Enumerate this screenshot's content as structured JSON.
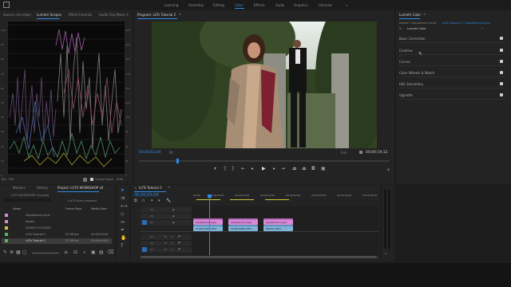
{
  "workspaces": {
    "items": [
      "Learning",
      "Assembly",
      "Editing",
      "Color",
      "Effects",
      "Audio",
      "Graphics",
      "Libraries"
    ],
    "active": "Color",
    "more": "»"
  },
  "scopes_panel": {
    "tabs": [
      "Source: (no clips)",
      "Lumetri Scopes",
      "Effect Controls",
      "Audio Clip Mixer: L"
    ],
    "active_tab": "Lumetri Scopes",
    "menu": "≡",
    "y_labels": [
      "100",
      "90",
      "80",
      "70",
      "60",
      "50",
      "40",
      "30",
      "20",
      "10",
      "0"
    ],
    "y_labels_right": [
      "255",
      "230",
      "204",
      "178",
      "153",
      "128",
      "102",
      "76",
      "51",
      "26",
      "0"
    ],
    "footer_left": "Rec. 709",
    "footer_clamp": "Clamp Signal",
    "footer_bits": "8 Bit"
  },
  "program_monitor": {
    "title": "Program: LUTs Tutorial 2",
    "menu": "≡",
    "timecode": "00;00;03;04",
    "fit": "Fit",
    "quality": "Full",
    "duration": "00;00;19;12"
  },
  "lumetri_color": {
    "tab": "Lumetri Color",
    "menu": "≡",
    "master": "Master * Adjustment Layer",
    "sequence": "LUTs Tutorial 2 * Adjustment Layer",
    "effect": "Lumetri Color",
    "fx": "fx",
    "sections": [
      "Basic Correction",
      "Creative",
      "Curves",
      "Color Wheels & Match",
      "HSL Secondary",
      "Vignette"
    ]
  },
  "project_panel": {
    "tabs": [
      "Markers",
      "History",
      "Project: LUTS WORKSHOP v2"
    ],
    "active_tab": "Project: LUTS WORKSHOP v2",
    "menu": "≡",
    "path": "LUTS WORKSHOP v2.prproj",
    "selection_info": "1 of 5 items selected",
    "columns": [
      "Name",
      "Frame Rate",
      "Media Start"
    ],
    "rows": [
      {
        "name": "Adjustment Layer",
        "color": "#d889d8",
        "rate": "",
        "start": ""
      },
      {
        "name": "Assets",
        "color": "#e0c040",
        "rate": "",
        "start": ""
      },
      {
        "name": "SAMPLE FOOTAGE",
        "color": "#e0c040",
        "rate": "",
        "start": ""
      },
      {
        "name": "LUTs Tutorial 1",
        "color": "#5fb25f",
        "rate": "23.98 fps",
        "start": "00;00;00;00"
      },
      {
        "name": "LUTs Tutorial 2",
        "color": "#5fb25f",
        "rate": "23.98 fps",
        "start": "00;00;00;00"
      }
    ]
  },
  "timeline": {
    "tab": "LUTs Tutorial 2",
    "menu": "≡",
    "timecode": "00;00;03;04",
    "ruler": [
      "00;00",
      "00;00;05;00",
      "00;00;10;00",
      "00;00;15;00",
      "00;00;20;00",
      "00;00;25;00",
      "00;00;30;00",
      "00;00;35;00"
    ],
    "video_tracks": [
      "V3",
      "V2",
      "V1"
    ],
    "audio_tracks": [
      "A1",
      "A2",
      "A3"
    ],
    "clips": {
      "v2": [
        "Adjustment Layer",
        "Adjustment Layer",
        "Adjustment Layer"
      ],
      "v1": [
        "STORYLINES.MOV",
        "STORYLINES.MOV",
        "BRIDAL.MOV"
      ]
    }
  },
  "meters": {
    "labels": [
      "0",
      "-12",
      "-24",
      "-36",
      "-48",
      "dB"
    ],
    "solo": "S"
  }
}
